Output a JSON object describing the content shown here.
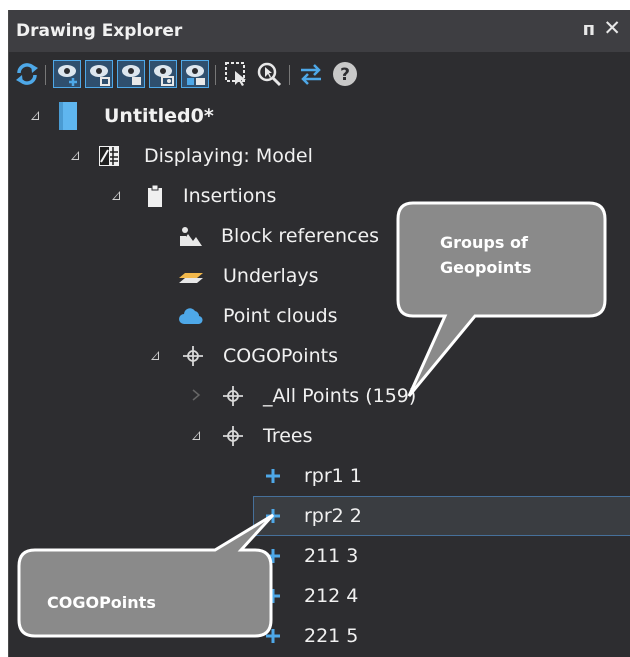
{
  "panel": {
    "title": "Drawing Explorer",
    "pin_glyph": "ᴨ",
    "close_glyph": "✕"
  },
  "toolbar": {
    "icons": [
      "refresh-icon",
      "eye-add-icon",
      "eye-square-icon",
      "eye-fill-icon",
      "eye-circle-icon",
      "eye-layers-icon",
      "select-cursor-icon",
      "zoom-to-icon",
      "swap-arrows-icon",
      "help-icon"
    ]
  },
  "tree": {
    "root": "Untitled0*",
    "displaying": "Displaying: Model",
    "insertions": "Insertions",
    "block_references": "Block references",
    "underlays": "Underlays",
    "point_clouds": "Point clouds",
    "cogo_points": "COGOPoints",
    "all_points": "_All Points (159)",
    "trees": "Trees",
    "points": [
      "rpr1 1",
      "rpr2 2",
      "211 3",
      "212 4",
      "221 5"
    ]
  },
  "callouts": {
    "groups": [
      "Groups of",
      "Geopoints"
    ],
    "cogo": "COGOPoints"
  },
  "colors": {
    "accent_blue": "#4ea8e8",
    "panel_bg": "#2d2d30",
    "callout_fill": "#8a8a8a"
  }
}
